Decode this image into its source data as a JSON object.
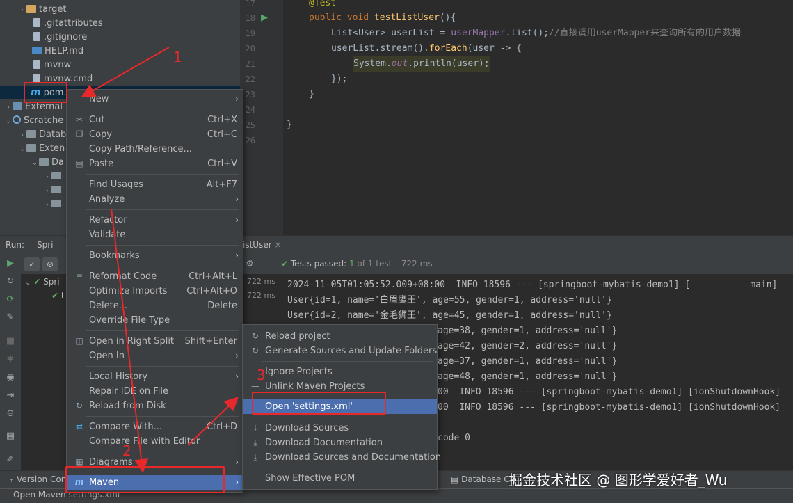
{
  "project_tree": {
    "items": [
      {
        "label": "target",
        "kind": "folder-orange",
        "indent": 1,
        "twisty": ">"
      },
      {
        "label": ".gitattributes",
        "kind": "file",
        "indent": 2
      },
      {
        "label": ".gitignore",
        "kind": "file",
        "indent": 2
      },
      {
        "label": "HELP.md",
        "kind": "md",
        "indent": 2
      },
      {
        "label": "mvnw",
        "kind": "file",
        "indent": 2
      },
      {
        "label": "mvnw.cmd",
        "kind": "file",
        "indent": 2
      },
      {
        "label": "pom.",
        "kind": "maven",
        "indent": 2,
        "selected": true
      },
      {
        "label": "External",
        "kind": "lib",
        "indent": 0,
        "twisty": ">"
      },
      {
        "label": "Scratche",
        "kind": "scratch",
        "indent": 0,
        "twisty": "v"
      },
      {
        "label": "Datab",
        "kind": "folder",
        "indent": 1,
        "twisty": ">"
      },
      {
        "label": "Exten",
        "kind": "folder",
        "indent": 1,
        "twisty": "v"
      },
      {
        "label": "Da",
        "kind": "folder",
        "indent": 2,
        "twisty": "v"
      },
      {
        "label": "",
        "kind": "folder",
        "indent": 3,
        "twisty": ">"
      },
      {
        "label": "",
        "kind": "folder",
        "indent": 3,
        "twisty": ">"
      },
      {
        "label": "",
        "kind": "folder",
        "indent": 3,
        "twisty": ">"
      }
    ]
  },
  "editor": {
    "line_numbers": [
      "17",
      "18",
      "19",
      "20",
      "21",
      "22",
      "23",
      "24",
      "25",
      "26"
    ],
    "lines": {
      "l17": "@Test",
      "l18_kw": "public void ",
      "l18_fn": "testListUser",
      "l18_rest": "(){",
      "l19_a": "List<User> userList = ",
      "l19_field": "userMapper",
      "l19_b": ".list();",
      "l19_comment": "//直接调用userMapper来查询所有的用户数据",
      "l20_a": "userList.stream().",
      "l20_fn": "forEach",
      "l20_b": "(user -> {",
      "l21_a": "System.",
      "l21_out": "out",
      "l21_b": ".println(user);",
      "l22": "});",
      "l23": "}",
      "l25": "}"
    }
  },
  "run_panel": {
    "run_label": "Run:",
    "run_tab": "Spri",
    "test_tab": "istUser",
    "tests_passed_label": "Tests passed:",
    "tests_passed_count": "1",
    "tests_passed_rest": "of 1 test – 722 ms",
    "test_tree": [
      {
        "label": "Spri",
        "time": "722 ms"
      },
      {
        "label": "t",
        "time": "722 ms"
      }
    ]
  },
  "console": {
    "lines": [
      "2024-11-05T01:05:52.009+08:00  INFO 18596 --- [springboot-mybatis-demo1] [           main]",
      "User{id=1, name='白眉鹰王', age=55, gender=1, address='null'}",
      "User{id=2, name='金毛狮王', age=45, gender=1, address='null'}",
      "age=38, gender=1, address='null'}",
      "age=42, gender=2, address='null'}",
      "age=37, gender=1, address='null'}",
      "age=48, gender=1, address='null'}",
      "00  INFO 18596 --- [springboot-mybatis-demo1] [ionShutdownHook]",
      "00  INFO 18596 --- [springboot-mybatis-demo1] [ionShutdownHook]",
      "",
      "code 0"
    ]
  },
  "context_menu": {
    "items": [
      {
        "label": "New",
        "shortcut": "",
        "submenu": true,
        "icon": ""
      },
      {
        "label": "Cut",
        "shortcut": "Ctrl+X",
        "icon": "✂"
      },
      {
        "label": "Copy",
        "shortcut": "Ctrl+C",
        "icon": "❐"
      },
      {
        "label": "Copy Path/Reference...",
        "shortcut": "",
        "icon": ""
      },
      {
        "label": "Paste",
        "shortcut": "Ctrl+V",
        "icon": "▤"
      },
      {
        "label": "Find Usages",
        "shortcut": "Alt+F7",
        "icon": ""
      },
      {
        "label": "Analyze",
        "shortcut": "",
        "submenu": true,
        "icon": ""
      },
      {
        "label": "Refactor",
        "shortcut": "",
        "submenu": true,
        "icon": ""
      },
      {
        "label": "Validate",
        "shortcut": "",
        "icon": ""
      },
      {
        "label": "Bookmarks",
        "shortcut": "",
        "submenu": true,
        "icon": ""
      },
      {
        "label": "Reformat Code",
        "shortcut": "Ctrl+Alt+L",
        "icon": "≡"
      },
      {
        "label": "Optimize Imports",
        "shortcut": "Ctrl+Alt+O",
        "icon": ""
      },
      {
        "label": "Delete...",
        "shortcut": "Delete",
        "icon": ""
      },
      {
        "label": "Override File Type",
        "shortcut": "",
        "icon": ""
      },
      {
        "label": "Open in Right Split",
        "shortcut": "Shift+Enter",
        "icon": "◫"
      },
      {
        "label": "Open In",
        "shortcut": "",
        "submenu": true,
        "icon": ""
      },
      {
        "label": "Local History",
        "shortcut": "",
        "submenu": true,
        "icon": ""
      },
      {
        "label": "Repair IDE on File",
        "shortcut": "",
        "icon": ""
      },
      {
        "label": "Reload from Disk",
        "shortcut": "",
        "icon": "↻"
      },
      {
        "label": "Compare With...",
        "shortcut": "Ctrl+D",
        "icon": "⇄"
      },
      {
        "label": "Compare File with Editor",
        "shortcut": "",
        "icon": ""
      },
      {
        "label": "Diagrams",
        "shortcut": "",
        "submenu": true,
        "icon": "▦"
      },
      {
        "label": "Maven",
        "shortcut": "",
        "submenu": true,
        "icon": "m",
        "active": true
      }
    ]
  },
  "maven_submenu": {
    "items": [
      {
        "label": "Reload project",
        "icon": "↻"
      },
      {
        "label": "Generate Sources and Update Folders",
        "icon": "↻"
      },
      {
        "label": "Ignore Projects",
        "icon": ""
      },
      {
        "label": "Unlink Maven Projects",
        "icon": "—"
      },
      {
        "label": "Open 'settings.xml'",
        "icon": "",
        "active": true
      },
      {
        "label": "Download Sources",
        "icon": "⤓"
      },
      {
        "label": "Download Documentation",
        "icon": "⤓"
      },
      {
        "label": "Download Sources and Documentation",
        "icon": "⤓"
      },
      {
        "label": "Show Effective POM",
        "icon": ""
      }
    ]
  },
  "annotations": {
    "step1": "1",
    "step2": "2",
    "step3": "3",
    "color": "#e8282b"
  },
  "bottom_bar": {
    "version_control": "Version Con",
    "database_changes": "Database Ch"
  },
  "status_bar": {
    "text": "Open Maven settings.xml"
  },
  "watermark": "掘金技术社区 @ 图形学爱好者_Wu",
  "colors": {
    "menu_bg": "#3c3f41",
    "menu_active": "#4b6eaf",
    "editor_bg": "#2b2b2b",
    "keyword": "#cc7832",
    "function": "#ffc66d",
    "annotation": "#bbb529",
    "field": "#9876aa",
    "comment": "#808080"
  }
}
